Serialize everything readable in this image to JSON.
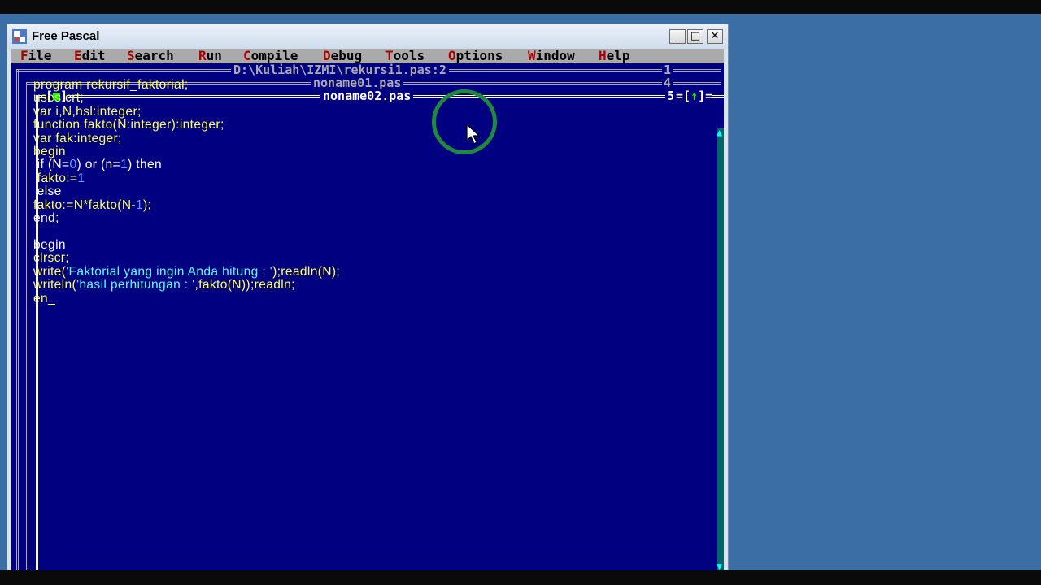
{
  "window": {
    "title": "Free Pascal",
    "buttons": {
      "minimize": "_",
      "maximize": "□",
      "close": "✕"
    }
  },
  "menu": [
    {
      "hotkey": "F",
      "rest": "ile"
    },
    {
      "hotkey": "E",
      "rest": "dit"
    },
    {
      "hotkey": "S",
      "rest": "earch"
    },
    {
      "hotkey": "R",
      "rest": "un"
    },
    {
      "hotkey": "C",
      "rest": "ompile"
    },
    {
      "hotkey": "D",
      "rest": "ebug"
    },
    {
      "hotkey": "T",
      "rest": "ools"
    },
    {
      "hotkey": "O",
      "rest": "ptions"
    },
    {
      "hotkey": "W",
      "rest": "indow"
    },
    {
      "hotkey": "H",
      "rest": "elp"
    }
  ],
  "editor_windows": [
    {
      "title": "D:\\Kuliah\\IZMI\\rekursi1.pas:2",
      "number": "1"
    },
    {
      "title": "noname01.pas",
      "number": "4"
    },
    {
      "title": "noname02.pas",
      "number": "5",
      "active": true
    }
  ],
  "active_window_controls": {
    "close": "[■]",
    "zoom": "[↑]"
  },
  "code": {
    "l1": "program rekursif_faktorial;",
    "l2": "uses crt;",
    "l3": "var i,N,hsl:integer;",
    "l4": "function fakto(N:integer):integer;",
    "l5": "var fak:integer;",
    "l6": "begin",
    "l7a": " if (N=",
    "l7b": "0",
    "l7c": ") or (n=",
    "l7d": "1",
    "l7e": ") then",
    "l8a": " fakto:=",
    "l8b": "1",
    "l9": " else",
    "l10a": "fakto:=N*fakto(N-",
    "l10b": "1",
    "l10c": ");",
    "l11": "end;",
    "l12": "",
    "l13": "begin",
    "l14": "clrscr;",
    "l15a": "write(",
    "l15b": "'Faktorial yang ingin Anda hitung : '",
    "l15c": ");readln(N);",
    "l16a": "writeln(",
    "l16b": "'hasil perhitungan : '",
    "l16c": ",fakto(N));readln;",
    "l17": "en_"
  },
  "colors": {
    "editor_bg": "#000080",
    "code_text": "#ffff55",
    "string_text": "#55ffff",
    "number_text": "#5f9cff",
    "desktop": "#3a6ea5",
    "cursor_highlight": "#1e8a3c"
  },
  "icons": [
    "free-pascal-icon",
    "mouse-pointer-icon",
    "scroll-up-icon",
    "scroll-down-icon"
  ]
}
